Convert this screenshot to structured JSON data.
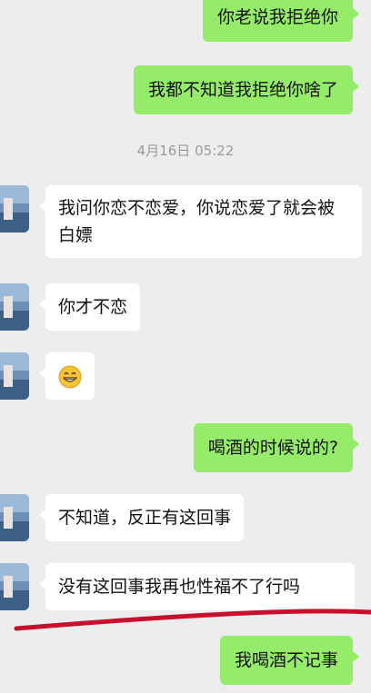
{
  "timestamp": "4月16日 05:22",
  "messages": [
    {
      "side": "out",
      "text": "你老说我拒绝你"
    },
    {
      "side": "out",
      "text": "我都不知道我拒绝你啥了"
    },
    {
      "side": "in",
      "text": "我问你恋不恋爱，你说恋爱了就会被白嫖"
    },
    {
      "side": "in",
      "text": "你才不恋"
    },
    {
      "side": "in",
      "emoji": "grinning-face-emoji"
    },
    {
      "side": "out",
      "text": "喝酒的时候说的?"
    },
    {
      "side": "in",
      "text": "不知道，反正有这回事"
    },
    {
      "side": "in",
      "text": "没有这回事我再也性福不了行吗"
    },
    {
      "side": "out",
      "text": "我喝酒不记事"
    }
  ],
  "colors": {
    "background": "#ededed",
    "outgoing_bubble": "#95ec69",
    "incoming_bubble": "#ffffff",
    "annotation_line": "#c8102e"
  }
}
